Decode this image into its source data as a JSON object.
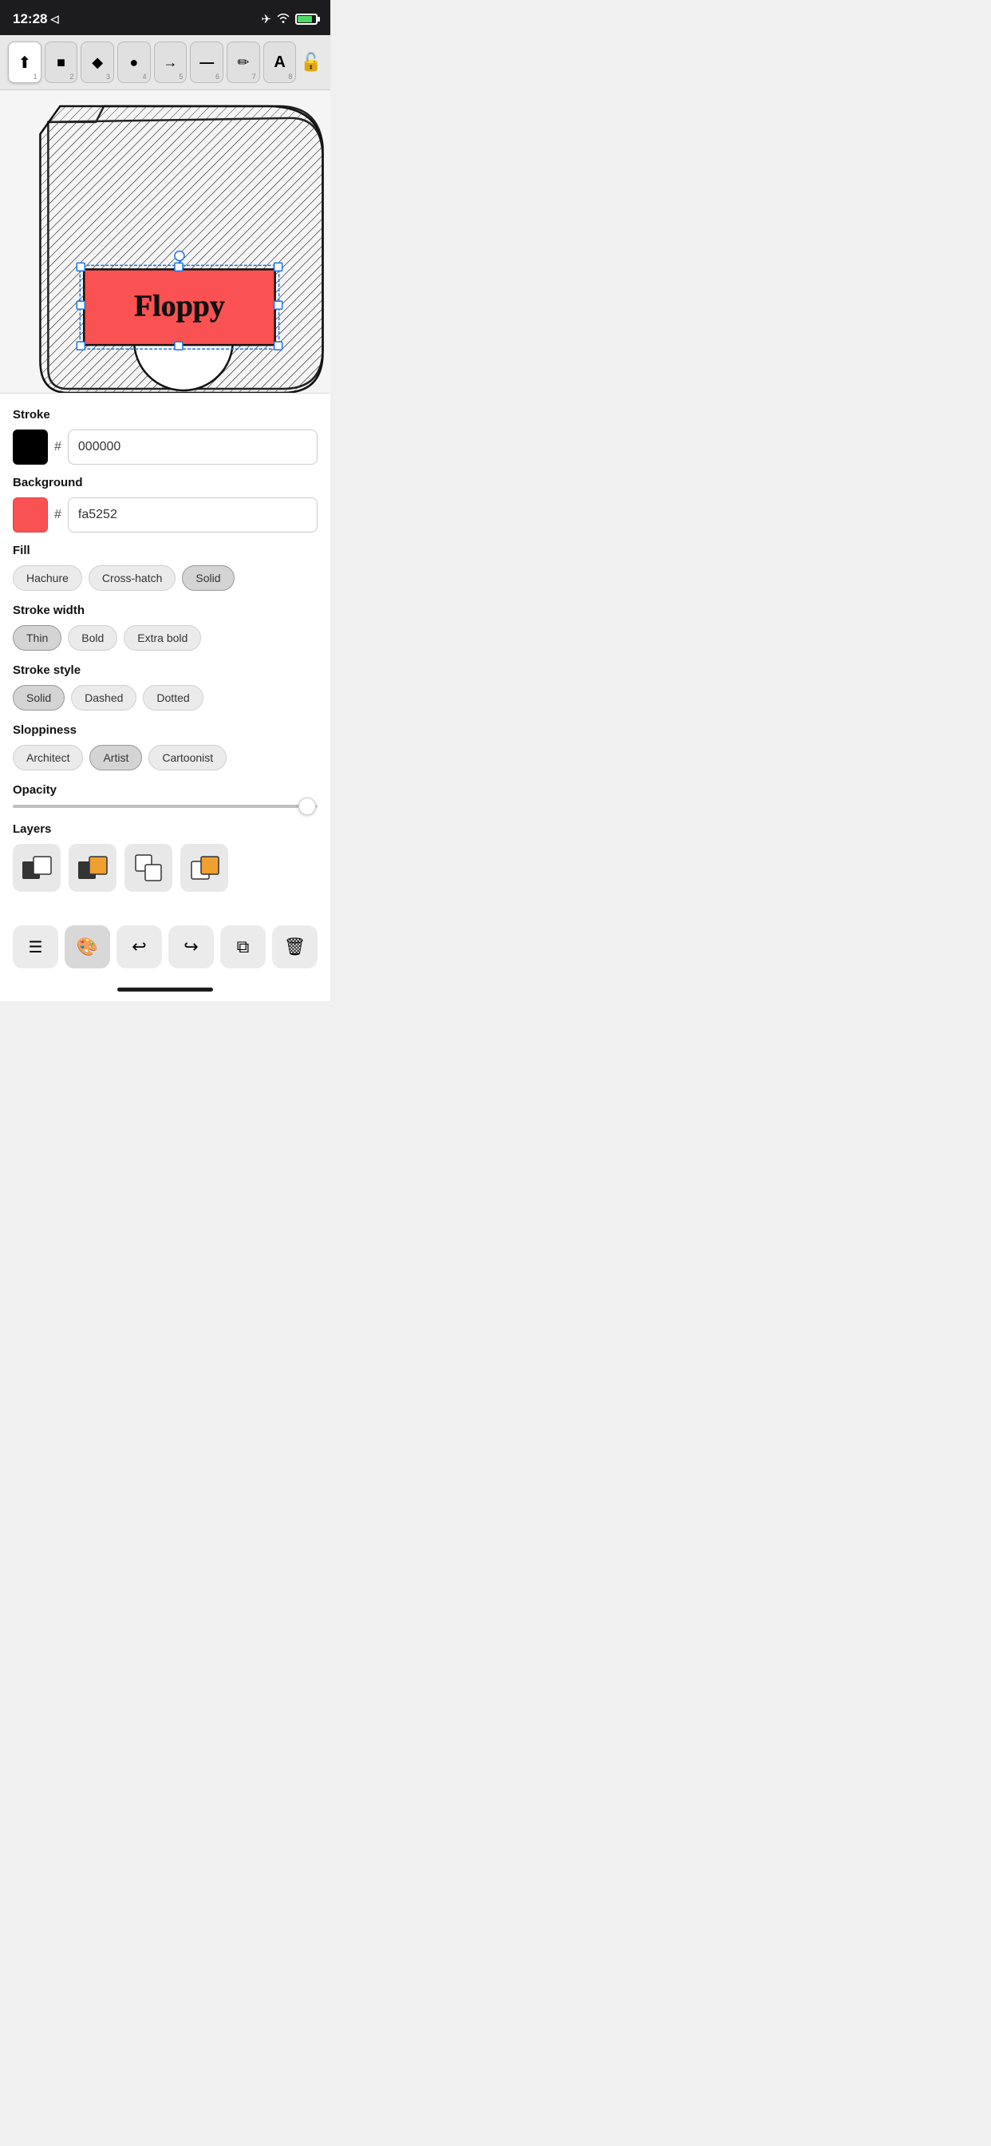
{
  "statusBar": {
    "time": "12:28",
    "locationIcon": "◁",
    "battery": "80"
  },
  "toolbar": {
    "tools": [
      {
        "id": "select",
        "icon": "▲",
        "number": "1",
        "active": true
      },
      {
        "id": "rect",
        "icon": "■",
        "number": "2",
        "active": false
      },
      {
        "id": "diamond",
        "icon": "◆",
        "number": "3",
        "active": false
      },
      {
        "id": "ellipse",
        "icon": "●",
        "number": "4",
        "active": false
      },
      {
        "id": "arrow",
        "icon": "→",
        "number": "5",
        "active": false
      },
      {
        "id": "line",
        "icon": "—",
        "number": "6",
        "active": false
      },
      {
        "id": "pencil",
        "icon": "✏",
        "number": "7",
        "active": false
      },
      {
        "id": "text",
        "icon": "A",
        "number": "8",
        "active": false
      }
    ],
    "lockIcon": "🔓"
  },
  "panel": {
    "stroke": {
      "label": "Stroke",
      "color": "#000000",
      "hex": "000000"
    },
    "background": {
      "label": "Background",
      "color": "#fa5252",
      "hex": "fa5252"
    },
    "fill": {
      "label": "Fill",
      "options": [
        "Hachure",
        "Cross-hatch",
        "Solid"
      ],
      "active": "Solid"
    },
    "strokeWidth": {
      "label": "Stroke width",
      "options": [
        "Thin",
        "Bold",
        "Extra bold"
      ],
      "active": "Thin"
    },
    "strokeStyle": {
      "label": "Stroke style",
      "options": [
        "Solid",
        "Dashed",
        "Dotted"
      ],
      "active": "Solid"
    },
    "sloppiness": {
      "label": "Sloppiness",
      "options": [
        "Architect",
        "Artist",
        "Cartoonist"
      ],
      "active": "Artist"
    },
    "opacity": {
      "label": "Opacity",
      "value": 95
    },
    "layers": {
      "label": "Layers",
      "items": [
        {
          "id": "layer1",
          "icon": "⬛"
        },
        {
          "id": "layer2",
          "icon": "🟧"
        },
        {
          "id": "layer3",
          "icon": "⬛"
        },
        {
          "id": "layer4",
          "icon": "🟧"
        }
      ]
    }
  },
  "actionBar": {
    "buttons": [
      {
        "id": "menu",
        "icon": "☰",
        "active": false
      },
      {
        "id": "style",
        "icon": "🎨",
        "active": true
      },
      {
        "id": "undo",
        "icon": "↩",
        "active": false
      },
      {
        "id": "redo",
        "icon": "↪",
        "active": false
      },
      {
        "id": "copy",
        "icon": "⧉",
        "active": false
      },
      {
        "id": "delete",
        "icon": "🗑",
        "active": false
      }
    ]
  }
}
